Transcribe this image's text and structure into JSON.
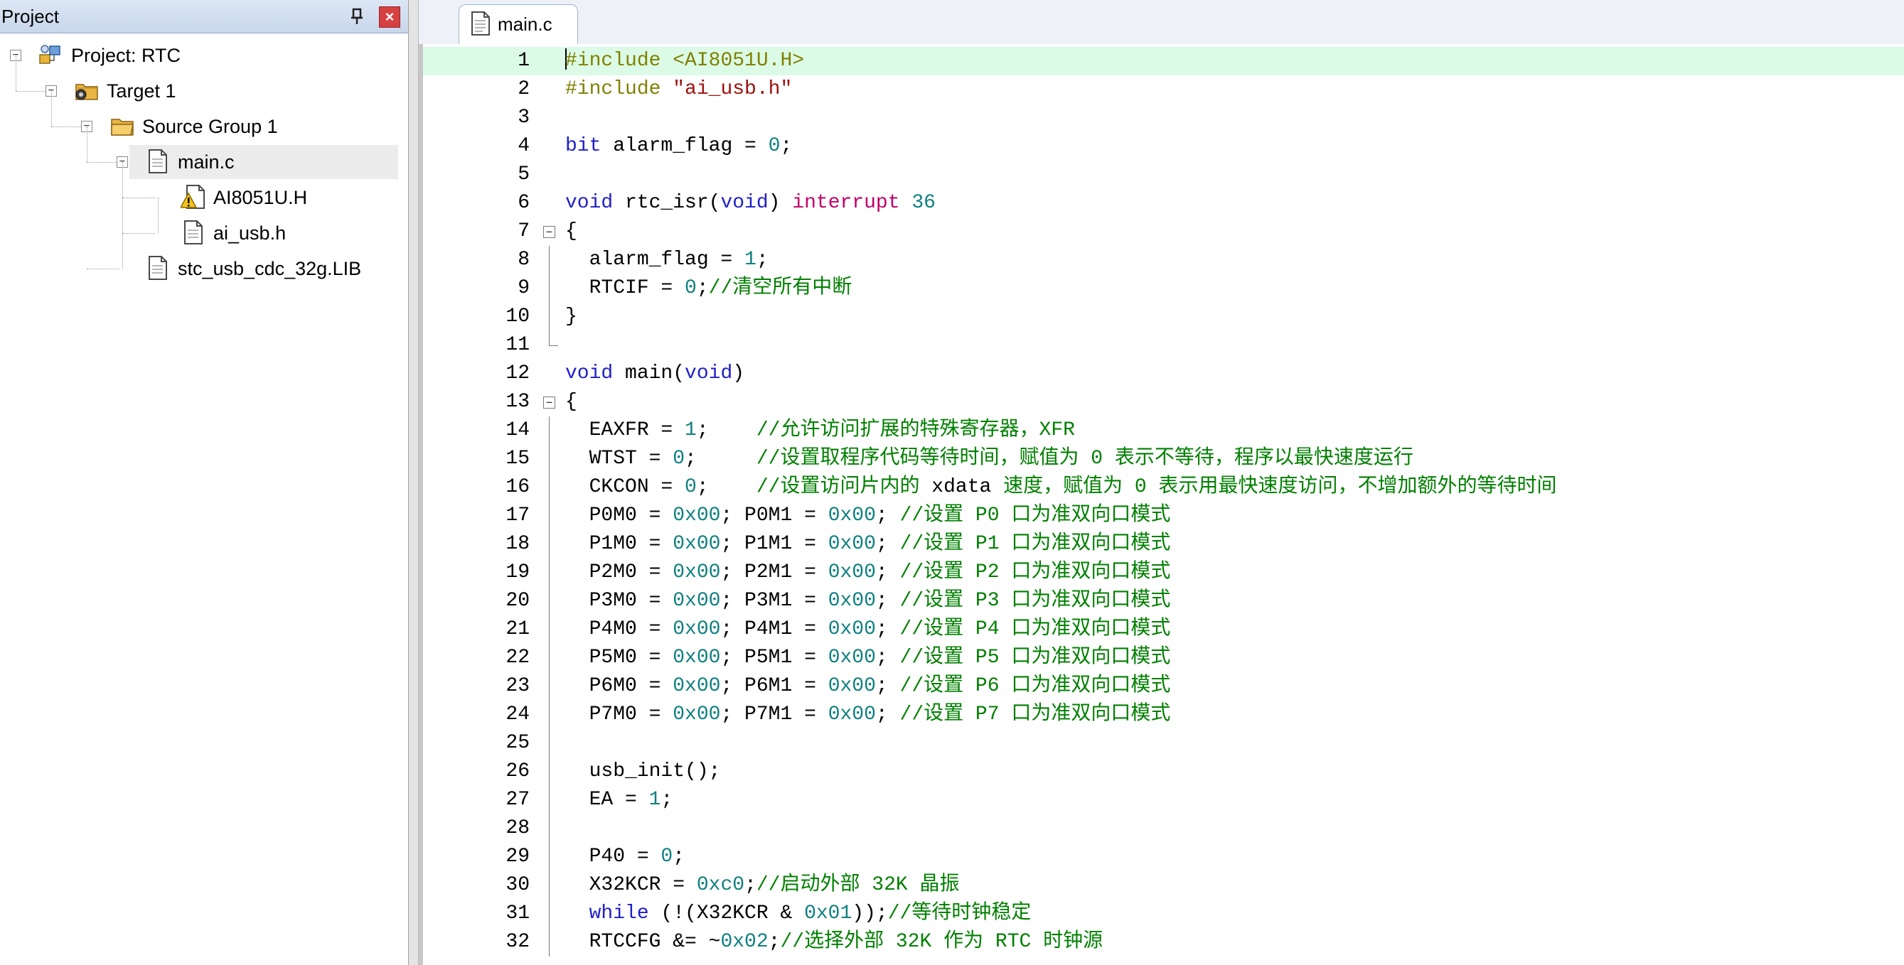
{
  "project_panel": {
    "title": "Project",
    "pin_glyph": "ᵽ",
    "close_glyph": "×",
    "tree": [
      {
        "label": "Project: RTC",
        "icon": "project-icon",
        "level": 0,
        "toggle": "−"
      },
      {
        "label": "Target 1",
        "icon": "target-icon",
        "level": 1,
        "toggle": "−"
      },
      {
        "label": "Source Group 1",
        "icon": "folder-icon",
        "level": 2,
        "toggle": "−"
      },
      {
        "label": "main.c",
        "icon": "file-icon",
        "level": 3,
        "toggle": "−",
        "selected": true
      },
      {
        "label": "AI8051U.H",
        "icon": "warning-file-icon",
        "level": 4
      },
      {
        "label": "ai_usb.h",
        "icon": "file-icon",
        "level": 4
      },
      {
        "label": "stc_usb_cdc_32g.LIB",
        "icon": "file-icon",
        "level": 3
      }
    ]
  },
  "editor": {
    "tab_label": "main.c",
    "current_line": 1,
    "lines": [
      {
        "n": 1,
        "tokens": [
          [
            "pp",
            "#include "
          ],
          [
            "pp",
            "<AI8051U.H>"
          ]
        ]
      },
      {
        "n": 2,
        "tokens": [
          [
            "pp",
            "#include "
          ],
          [
            "str",
            "\"ai_usb.h\""
          ]
        ]
      },
      {
        "n": 3,
        "tokens": []
      },
      {
        "n": 4,
        "tokens": [
          [
            "kw",
            "bit"
          ],
          [
            "plain",
            " alarm_flag = "
          ],
          [
            "num",
            "0"
          ],
          [
            "plain",
            ";"
          ]
        ]
      },
      {
        "n": 5,
        "tokens": []
      },
      {
        "n": 6,
        "tokens": [
          [
            "kw",
            "void"
          ],
          [
            "plain",
            " rtc_isr("
          ],
          [
            "kw",
            "void"
          ],
          [
            "plain",
            ") "
          ],
          [
            "ext",
            "interrupt"
          ],
          [
            "plain",
            " "
          ],
          [
            "num",
            "36"
          ]
        ]
      },
      {
        "n": 7,
        "fold": "open",
        "tokens": [
          [
            "plain",
            "{"
          ]
        ]
      },
      {
        "n": 8,
        "fold": "line",
        "tokens": [
          [
            "plain",
            "  alarm_flag = "
          ],
          [
            "num",
            "1"
          ],
          [
            "plain",
            ";"
          ]
        ]
      },
      {
        "n": 9,
        "fold": "line",
        "tokens": [
          [
            "plain",
            "  RTCIF = "
          ],
          [
            "num",
            "0"
          ],
          [
            "plain",
            ";"
          ],
          [
            "cmt",
            "//清空所有中断"
          ]
        ]
      },
      {
        "n": 10,
        "fold": "line",
        "tokens": [
          [
            "plain",
            "}"
          ]
        ]
      },
      {
        "n": 11,
        "fold": "end",
        "tokens": []
      },
      {
        "n": 12,
        "tokens": [
          [
            "kw",
            "void"
          ],
          [
            "plain",
            " main("
          ],
          [
            "kw",
            "void"
          ],
          [
            "plain",
            ")"
          ]
        ]
      },
      {
        "n": 13,
        "fold": "open",
        "tokens": [
          [
            "plain",
            "{"
          ]
        ]
      },
      {
        "n": 14,
        "fold": "line",
        "tokens": [
          [
            "plain",
            "  EAXFR = "
          ],
          [
            "num",
            "1"
          ],
          [
            "plain",
            ";    "
          ],
          [
            "cmt",
            "//允许访问扩展的特殊寄存器，XFR"
          ]
        ]
      },
      {
        "n": 15,
        "fold": "line",
        "tokens": [
          [
            "plain",
            "  WTST = "
          ],
          [
            "num",
            "0"
          ],
          [
            "plain",
            ";     "
          ],
          [
            "cmt",
            "//设置取程序代码等待时间，赋值为 0 表示不等待，程序以最快速度运行"
          ]
        ]
      },
      {
        "n": 16,
        "fold": "line",
        "tokens": [
          [
            "plain",
            "  CKCON = "
          ],
          [
            "num",
            "0"
          ],
          [
            "plain",
            ";    "
          ],
          [
            "cmt",
            "//设置访问片内的 "
          ],
          [
            "plain",
            "xdata"
          ],
          [
            "cmt",
            " 速度，赋值为 0 表示用最快速度访问，不增加额外的等待时间"
          ]
        ]
      },
      {
        "n": 17,
        "fold": "line",
        "tokens": [
          [
            "plain",
            "  P0M0 = "
          ],
          [
            "num",
            "0x00"
          ],
          [
            "plain",
            "; P0M1 = "
          ],
          [
            "num",
            "0x00"
          ],
          [
            "plain",
            "; "
          ],
          [
            "cmt",
            "//设置 P0 口为准双向口模式"
          ]
        ]
      },
      {
        "n": 18,
        "fold": "line",
        "tokens": [
          [
            "plain",
            "  P1M0 = "
          ],
          [
            "num",
            "0x00"
          ],
          [
            "plain",
            "; P1M1 = "
          ],
          [
            "num",
            "0x00"
          ],
          [
            "plain",
            "; "
          ],
          [
            "cmt",
            "//设置 P1 口为准双向口模式"
          ]
        ]
      },
      {
        "n": 19,
        "fold": "line",
        "tokens": [
          [
            "plain",
            "  P2M0 = "
          ],
          [
            "num",
            "0x00"
          ],
          [
            "plain",
            "; P2M1 = "
          ],
          [
            "num",
            "0x00"
          ],
          [
            "plain",
            "; "
          ],
          [
            "cmt",
            "//设置 P2 口为准双向口模式"
          ]
        ]
      },
      {
        "n": 20,
        "fold": "line",
        "tokens": [
          [
            "plain",
            "  P3M0 = "
          ],
          [
            "num",
            "0x00"
          ],
          [
            "plain",
            "; P3M1 = "
          ],
          [
            "num",
            "0x00"
          ],
          [
            "plain",
            "; "
          ],
          [
            "cmt",
            "//设置 P3 口为准双向口模式"
          ]
        ]
      },
      {
        "n": 21,
        "fold": "line",
        "tokens": [
          [
            "plain",
            "  P4M0 = "
          ],
          [
            "num",
            "0x00"
          ],
          [
            "plain",
            "; P4M1 = "
          ],
          [
            "num",
            "0x00"
          ],
          [
            "plain",
            "; "
          ],
          [
            "cmt",
            "//设置 P4 口为准双向口模式"
          ]
        ]
      },
      {
        "n": 22,
        "fold": "line",
        "tokens": [
          [
            "plain",
            "  P5M0 = "
          ],
          [
            "num",
            "0x00"
          ],
          [
            "plain",
            "; P5M1 = "
          ],
          [
            "num",
            "0x00"
          ],
          [
            "plain",
            "; "
          ],
          [
            "cmt",
            "//设置 P5 口为准双向口模式"
          ]
        ]
      },
      {
        "n": 23,
        "fold": "line",
        "tokens": [
          [
            "plain",
            "  P6M0 = "
          ],
          [
            "num",
            "0x00"
          ],
          [
            "plain",
            "; P6M1 = "
          ],
          [
            "num",
            "0x00"
          ],
          [
            "plain",
            "; "
          ],
          [
            "cmt",
            "//设置 P6 口为准双向口模式"
          ]
        ]
      },
      {
        "n": 24,
        "fold": "line",
        "tokens": [
          [
            "plain",
            "  P7M0 = "
          ],
          [
            "num",
            "0x00"
          ],
          [
            "plain",
            "; P7M1 = "
          ],
          [
            "num",
            "0x00"
          ],
          [
            "plain",
            "; "
          ],
          [
            "cmt",
            "//设置 P7 口为准双向口模式"
          ]
        ]
      },
      {
        "n": 25,
        "fold": "line",
        "tokens": []
      },
      {
        "n": 26,
        "fold": "line",
        "tokens": [
          [
            "plain",
            "  usb_init();"
          ]
        ]
      },
      {
        "n": 27,
        "fold": "line",
        "tokens": [
          [
            "plain",
            "  EA = "
          ],
          [
            "num",
            "1"
          ],
          [
            "plain",
            ";"
          ]
        ]
      },
      {
        "n": 28,
        "fold": "line",
        "tokens": []
      },
      {
        "n": 29,
        "fold": "line",
        "tokens": [
          [
            "plain",
            "  P40 = "
          ],
          [
            "num",
            "0"
          ],
          [
            "plain",
            ";"
          ]
        ]
      },
      {
        "n": 30,
        "fold": "line",
        "tokens": [
          [
            "plain",
            "  X32KCR = "
          ],
          [
            "num",
            "0xc0"
          ],
          [
            "plain",
            ";"
          ],
          [
            "cmt",
            "//启动外部 32K 晶振"
          ]
        ]
      },
      {
        "n": 31,
        "fold": "line",
        "tokens": [
          [
            "plain",
            "  "
          ],
          [
            "kw",
            "while"
          ],
          [
            "plain",
            " (!(X32KCR & "
          ],
          [
            "num",
            "0x01"
          ],
          [
            "plain",
            "));"
          ],
          [
            "cmt",
            "//等待时钟稳定"
          ]
        ]
      },
      {
        "n": 32,
        "fold": "line",
        "tokens": [
          [
            "plain",
            "  RTCCFG &= ~"
          ],
          [
            "num",
            "0x02"
          ],
          [
            "plain",
            ";"
          ],
          [
            "cmt",
            "//选择外部 32K 作为 RTC 时钟源"
          ]
        ]
      }
    ]
  },
  "colors": {
    "current_line_bg": "#dcfbe6",
    "keyword": "#1f1fc8",
    "preprocessor": "#808000",
    "string": "#a01010",
    "number": "#108080",
    "comment": "#008000",
    "extension_keyword": "#c0006a"
  }
}
